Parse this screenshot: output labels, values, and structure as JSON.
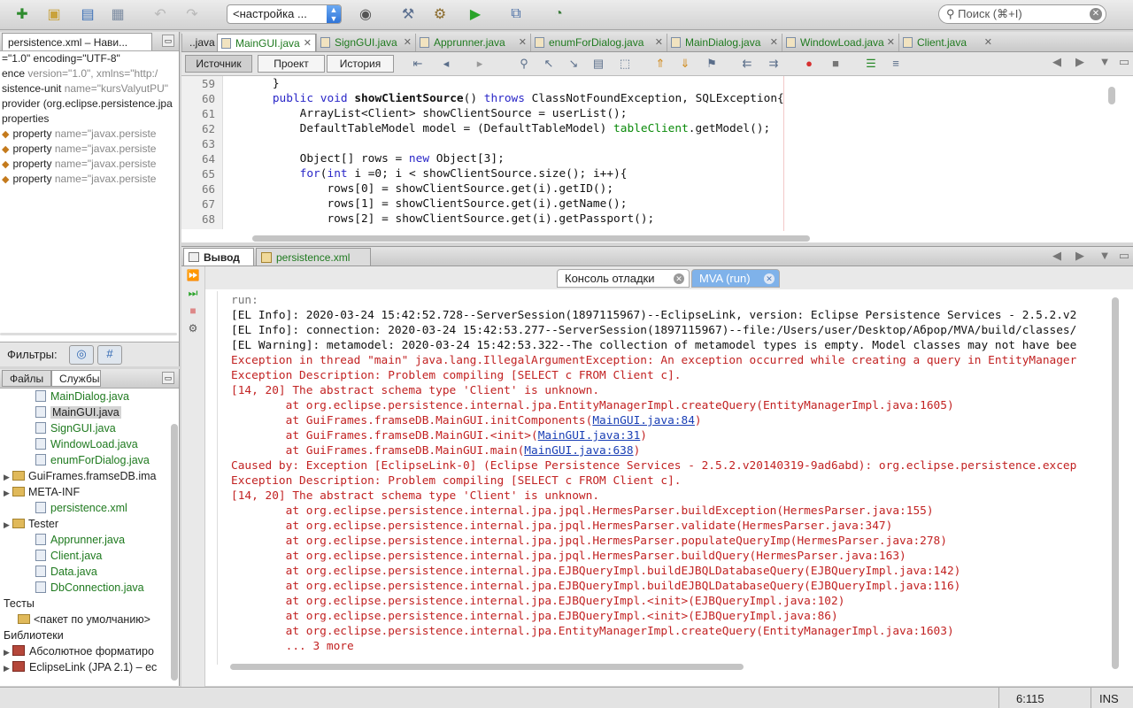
{
  "toolbar": {
    "config": "<настройка ...",
    "search_placeholder": "Поиск (⌘+I)"
  },
  "navigator": {
    "tab": "persistence.xml – Нави...",
    "lines": [
      {
        "tag": "=\"1.0\" encoding=\"UTF-8\"",
        "attrs": "",
        "icon": false
      },
      {
        "tag": "ence",
        "attrs": " version=\"1.0\", xmlns=\"http:/",
        "icon": false
      },
      {
        "tag": "sistence-unit",
        "attrs": " name=\"kursValyutPU\"",
        "icon": false
      },
      {
        "tag": "provider (org.eclipse.persistence.jpa",
        "attrs": "",
        "icon": false
      },
      {
        "tag": "properties",
        "attrs": "",
        "icon": false
      },
      {
        "tag": "property",
        "attrs": " name=\"javax.persiste",
        "icon": true
      },
      {
        "tag": "property",
        "attrs": " name=\"javax.persiste",
        "icon": true
      },
      {
        "tag": "property",
        "attrs": " name=\"javax.persiste",
        "icon": true
      },
      {
        "tag": "property",
        "attrs": " name=\"javax.persiste",
        "icon": true
      }
    ],
    "filters_label": "Фильтры:"
  },
  "projects": {
    "tabs": [
      "Файлы",
      "Службы"
    ],
    "tree": [
      {
        "label": "MainDialog.java",
        "kind": "java",
        "indent": 40
      },
      {
        "label": "MainGUI.java",
        "kind": "java-sel",
        "indent": 40
      },
      {
        "label": "SignGUI.java",
        "kind": "java",
        "indent": 40
      },
      {
        "label": "WindowLoad.java",
        "kind": "java",
        "indent": 40
      },
      {
        "label": "enumForDialog.java",
        "kind": "java",
        "indent": 40
      },
      {
        "label": "GuiFrames.framseDB.ima",
        "kind": "pkg",
        "indent": 4
      },
      {
        "label": "META-INF",
        "kind": "pkg",
        "indent": 4
      },
      {
        "label": "persistence.xml",
        "kind": "xml",
        "indent": 40
      },
      {
        "label": "Tester",
        "kind": "pkg",
        "indent": 4
      },
      {
        "label": "Apprunner.java",
        "kind": "java",
        "indent": 40
      },
      {
        "label": "Client.java",
        "kind": "java",
        "indent": 40
      },
      {
        "label": "Data.java",
        "kind": "java",
        "indent": 40
      },
      {
        "label": "DbConnection.java",
        "kind": "java",
        "indent": 40
      },
      {
        "label": "Тесты",
        "kind": "plain",
        "indent": 4
      },
      {
        "label": "<пакет по умолчанию>",
        "kind": "pkg2",
        "indent": 20
      },
      {
        "label": "Библиотеки",
        "kind": "plain",
        "indent": 4
      },
      {
        "label": "Абсолютное форматиро",
        "kind": "lib",
        "indent": 4
      },
      {
        "label": "EclipseLink (JPA 2.1) – ec",
        "kind": "lib",
        "indent": 4
      }
    ]
  },
  "editor": {
    "tabs": [
      {
        "label": "..java",
        "active": false
      },
      {
        "label": "MainGUI.java",
        "active": true
      },
      {
        "label": "SignGUI.java",
        "active": false
      },
      {
        "label": "Apprunner.java",
        "active": false
      },
      {
        "label": "enumForDialog.java",
        "active": false
      },
      {
        "label": "MainDialog.java",
        "active": false
      },
      {
        "label": "WindowLoad.java",
        "active": false
      },
      {
        "label": "Client.java",
        "active": false
      }
    ],
    "modes": [
      "Источник",
      "Проект",
      "История"
    ],
    "line_numbers": [
      "59",
      "60",
      "61",
      "62",
      "63",
      "64",
      "65",
      "66",
      "67",
      "68"
    ],
    "code": [
      "    }",
      "    public void showClientSource() throws ClassNotFoundException, SQLException{",
      "        ArrayList<Client> showClientSource = userList();",
      "        DefaultTableModel model = (DefaultTableModel) tableClient.getModel();",
      "",
      "        Object[] rows = new Object[3];",
      "        for(int i =0; i < showClientSource.size(); i++){",
      "            rows[0] = showClientSource.get(i).getID();",
      "            rows[1] = showClientSource.get(i).getName();",
      "            rows[2] = showClientSource.get(i).getPassport();"
    ]
  },
  "output": {
    "tabs": [
      "Вывод",
      "persistence.xml"
    ],
    "subtabs": [
      "Консоль отладки",
      "MVA (run)"
    ],
    "lines": [
      {
        "t": "run:",
        "c": "dimt"
      },
      {
        "t": "[EL Info]: 2020-03-24 15:42:52.728--ServerSession(1897115967)--EclipseLink, version: Eclipse Persistence Services - 2.5.2.v2",
        "c": "ok"
      },
      {
        "t": "[EL Info]: connection: 2020-03-24 15:42:53.277--ServerSession(1897115967)--file:/Users/user/Desktop/Аброр/MVA/build/classes/",
        "c": "ok"
      },
      {
        "t": "[EL Warning]: metamodel: 2020-03-24 15:42:53.322--The collection of metamodel types is empty. Model classes may not have bee",
        "c": "ok"
      },
      {
        "t": "Exception in thread \"main\" java.lang.IllegalArgumentException: An exception occurred while creating a query in EntityManager",
        "c": "err"
      },
      {
        "t": "Exception Description: Problem compiling [SELECT c FROM Client c].",
        "c": "err"
      },
      {
        "t": "[14, 20] The abstract schema type 'Client' is unknown.",
        "c": "err"
      },
      {
        "t": "        at org.eclipse.persistence.internal.jpa.EntityManagerImpl.createQuery(EntityManagerImpl.java:1605)",
        "c": "err"
      },
      {
        "t": "        at GuiFrames.framseDB.MainGUI.initComponents(",
        "c": "err",
        "link": "MainGUI.java:84",
        "tail": ")"
      },
      {
        "t": "        at GuiFrames.framseDB.MainGUI.<init>(",
        "c": "err",
        "link": "MainGUI.java:31",
        "tail": ")"
      },
      {
        "t": "        at GuiFrames.framseDB.MainGUI.main(",
        "c": "err",
        "link": "MainGUI.java:638",
        "tail": ")"
      },
      {
        "t": "Caused by: Exception [EclipseLink-0] (Eclipse Persistence Services - 2.5.2.v20140319-9ad6abd): org.eclipse.persistence.excep",
        "c": "err"
      },
      {
        "t": "Exception Description: Problem compiling [SELECT c FROM Client c].",
        "c": "err"
      },
      {
        "t": "[14, 20] The abstract schema type 'Client' is unknown.",
        "c": "err"
      },
      {
        "t": "        at org.eclipse.persistence.internal.jpa.jpql.HermesParser.buildException(HermesParser.java:155)",
        "c": "err"
      },
      {
        "t": "        at org.eclipse.persistence.internal.jpa.jpql.HermesParser.validate(HermesParser.java:347)",
        "c": "err"
      },
      {
        "t": "        at org.eclipse.persistence.internal.jpa.jpql.HermesParser.populateQueryImp(HermesParser.java:278)",
        "c": "err"
      },
      {
        "t": "        at org.eclipse.persistence.internal.jpa.jpql.HermesParser.buildQuery(HermesParser.java:163)",
        "c": "err"
      },
      {
        "t": "        at org.eclipse.persistence.internal.jpa.EJBQueryImpl.buildEJBQLDatabaseQuery(EJBQueryImpl.java:142)",
        "c": "err"
      },
      {
        "t": "        at org.eclipse.persistence.internal.jpa.EJBQueryImpl.buildEJBQLDatabaseQuery(EJBQueryImpl.java:116)",
        "c": "err"
      },
      {
        "t": "        at org.eclipse.persistence.internal.jpa.EJBQueryImpl.<init>(EJBQueryImpl.java:102)",
        "c": "err"
      },
      {
        "t": "        at org.eclipse.persistence.internal.jpa.EJBQueryImpl.<init>(EJBQueryImpl.java:86)",
        "c": "err"
      },
      {
        "t": "        at org.eclipse.persistence.internal.jpa.EntityManagerImpl.createQuery(EntityManagerImpl.java:1603)",
        "c": "err"
      },
      {
        "t": "        ... 3 more",
        "c": "err"
      }
    ]
  },
  "status": {
    "position": "6:115",
    "mode": "INS"
  }
}
